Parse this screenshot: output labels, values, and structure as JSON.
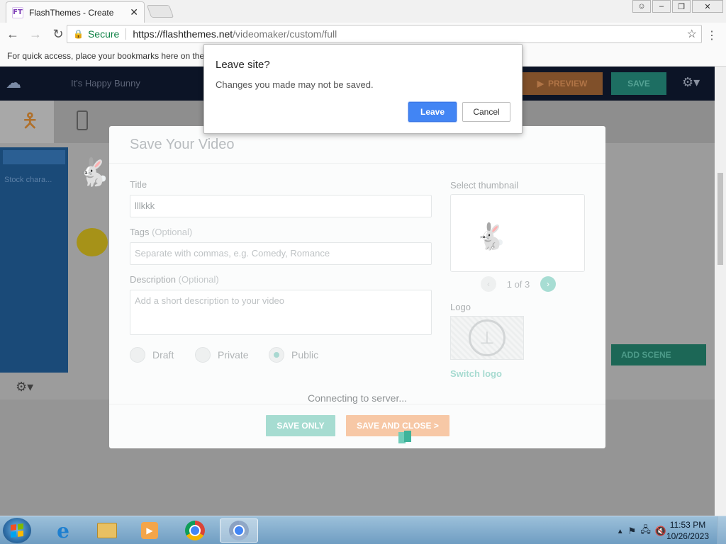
{
  "browser": {
    "tab_title": "FlashThemes - Create",
    "tab_close": "✕",
    "favicon_text": "FT",
    "secure_label": "Secure",
    "url_host": "https://flashthemes.net",
    "url_path": "/videomaker/custom/full",
    "bookmarks_hint": "For quick access, place your bookmarks here on the b"
  },
  "app": {
    "title": "It's Happy Bunny",
    "preview_label": "PREVIEW",
    "save_label": "SAVE",
    "left_item": "Stock chara...",
    "add_scene_label": "ADD SCENE"
  },
  "modal": {
    "title": "Save Your Video",
    "title_label": "Title",
    "title_value": "lllkkk",
    "tags_label": "Tags",
    "tags_optional": "(Optional)",
    "tags_placeholder": "Separate with commas, e.g. Comedy, Romance",
    "description_label": "Description",
    "description_optional": "(Optional)",
    "description_placeholder": "Add a short description to your video",
    "privacy": {
      "draft": "Draft",
      "private": "Private",
      "public": "Public",
      "selected": "Public"
    },
    "thumbnail_label": "Select thumbnail",
    "thumbnail_pager": "1 of 3",
    "logo_label": "Logo",
    "switch_logo": "Switch logo",
    "status": "Connecting to server...",
    "save_only": "SAVE ONLY",
    "save_and_close": "SAVE AND CLOSE >"
  },
  "dialog": {
    "title": "Leave site?",
    "message": "Changes you made may not be saved.",
    "leave": "Leave",
    "cancel": "Cancel"
  },
  "taskbar": {
    "time": "11:53 PM",
    "date": "10/26/2023"
  },
  "colors": {
    "dialog_primary": "#4285f4",
    "modal_teal": "#a6dcd1",
    "modal_orange": "#f7c8a6"
  }
}
